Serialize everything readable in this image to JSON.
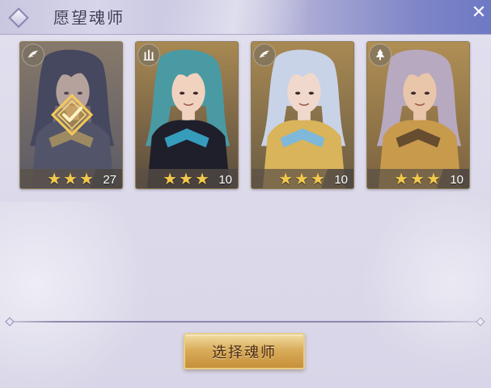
{
  "dialog": {
    "title": "愿望魂师",
    "close_label": "✕"
  },
  "cards": [
    {
      "name": "card-1",
      "class_icon": "wing-icon",
      "stars": "★★★",
      "level": "27",
      "selected": true,
      "colors": {
        "bg_top": "#8f7a58",
        "bg_bottom": "#4d4a52",
        "hair": "#2a2e48",
        "skin": "#d7b9a6",
        "cloth": "#3e4356",
        "accent": "#c7a24a"
      }
    },
    {
      "name": "card-2",
      "class_icon": "tower-icon",
      "stars": "★★★",
      "level": "10",
      "selected": false,
      "colors": {
        "bg_top": "#a88952",
        "bg_bottom": "#5a4b3e",
        "hair": "#4a9aa3",
        "skin": "#f1d2bf",
        "cloth": "#1e1f2a",
        "accent": "#3bb3d6"
      }
    },
    {
      "name": "card-3",
      "class_icon": "wing-icon",
      "stars": "★★★",
      "level": "10",
      "selected": false,
      "colors": {
        "bg_top": "#a88952",
        "bg_bottom": "#6a5c44",
        "hair": "#c9d3e8",
        "skin": "#f0d9cc",
        "cloth": "#d9b45a",
        "accent": "#6fb8ef"
      }
    },
    {
      "name": "card-4",
      "class_icon": "tree-icon",
      "stars": "★★★",
      "level": "10",
      "selected": false,
      "colors": {
        "bg_top": "#b08f55",
        "bg_bottom": "#7a6240",
        "hair": "#b7a9bf",
        "skin": "#e9c5aa",
        "cloth": "#c89a4c",
        "accent": "#55402a"
      }
    }
  ],
  "button": {
    "label": "选择魂师"
  }
}
